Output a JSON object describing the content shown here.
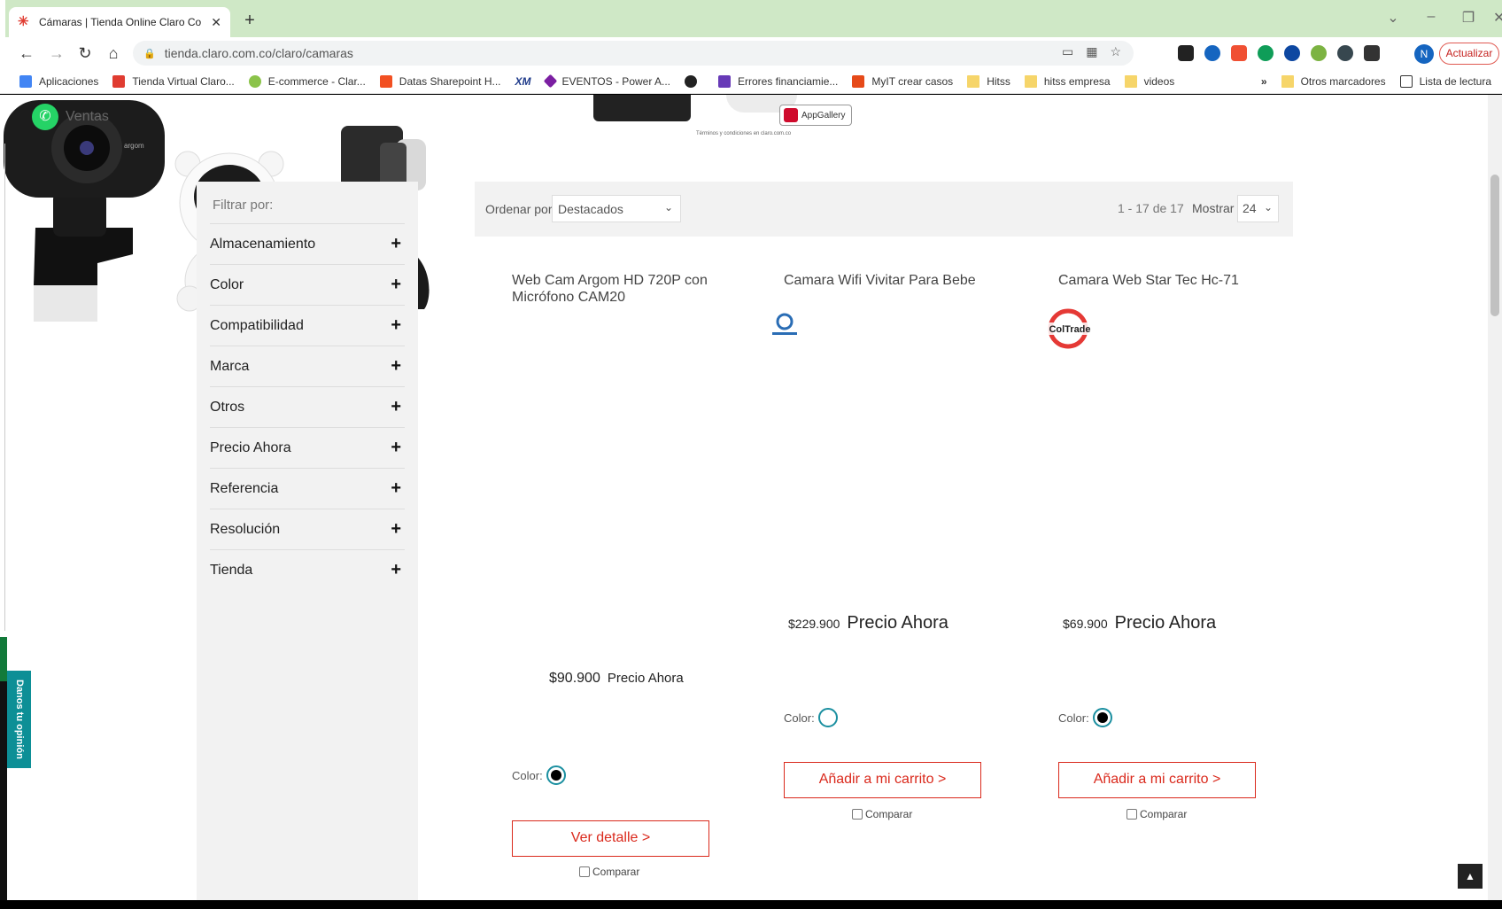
{
  "browser": {
    "tab_title": "Cámaras | Tienda Online Claro Co",
    "url": "tienda.claro.com.co/claro/camaras",
    "profile_initial": "N",
    "update_label": "Actualizar"
  },
  "bookmarks": [
    {
      "label": "Aplicaciones",
      "color": "#4285f4"
    },
    {
      "label": "Tienda Virtual Claro...",
      "color": "#e03c31"
    },
    {
      "label": "E-commerce - Clar...",
      "color": "#8bc34a"
    },
    {
      "label": "Datas Sharepoint H...",
      "color": "#f25022"
    },
    {
      "label": "XM",
      "color": "#1e3a8a"
    },
    {
      "label": "EVENTOS - Power A...",
      "color": "#7b1fa2"
    },
    {
      "label": "",
      "color": "#222222"
    },
    {
      "label": "Errores financiamie...",
      "color": "#673ab7"
    },
    {
      "label": "MyIT crear casos",
      "color": "#e64a19"
    },
    {
      "label": "Hitss",
      "color": "#f6d56a",
      "folder": true
    },
    {
      "label": "hitss empresa",
      "color": "#f6d56a",
      "folder": true
    },
    {
      "label": "videos",
      "color": "#f6d56a",
      "folder": true
    }
  ],
  "bookmarks_right": {
    "more": "»",
    "other": "Otros marcadores",
    "reading": "Lista de lectura"
  },
  "page": {
    "whatsapp_label": "Ventas",
    "banner_appgallery": "AppGallery",
    "banner_terms": "Términos y condiciones en claro.com.co",
    "feedback_label": "Danos tu opinión",
    "filters_title": "Filtrar por:",
    "filters": [
      "Almacenamiento",
      "Color",
      "Compatibilidad",
      "Marca",
      "Otros",
      "Precio Ahora",
      "Referencia",
      "Resolución",
      "Tienda"
    ],
    "sort_label": "Ordenar por",
    "sort_value": "Destacados",
    "results_count": "1 - 17 de 17",
    "show_label": "Mostrar",
    "show_value": "24"
  },
  "products": [
    {
      "name": "Web Cam Argom HD 720P con Micrófono CAM20",
      "price": "$90.900",
      "price_label": "Precio Ahora",
      "color_label": "Color:",
      "swatch": "black",
      "cta": "Ver detalle >",
      "compare": "Comparar"
    },
    {
      "name": "Camara Wifi Vivitar Para Bebe",
      "price": "$229.900",
      "price_label": "Precio Ahora",
      "color_label": "Color:",
      "swatch": "white",
      "cta": "Añadir a mi carrito >",
      "compare": "Comparar"
    },
    {
      "name": "Camara Web Star Tec Hc-71",
      "price": "$69.900",
      "price_label": "Precio Ahora",
      "color_label": "Color:",
      "swatch": "black",
      "cta": "Añadir a mi carrito >",
      "compare": "Comparar"
    }
  ],
  "brand_logos": {
    "coltrade": "ColTrade"
  },
  "colors": {
    "claro_red": "#da291c",
    "accent_teal": "#1a8fa0",
    "tab_bar": "#cfe8c6"
  }
}
